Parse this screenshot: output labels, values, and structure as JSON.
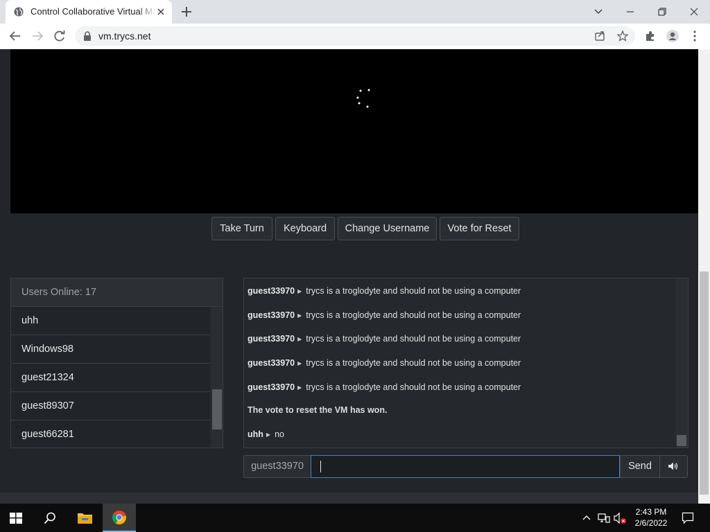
{
  "browser": {
    "tab_title": "Control Collaborative Virtual Machines",
    "url": "vm.trycs.net"
  },
  "vm": {
    "buttons": [
      "Take Turn",
      "Keyboard",
      "Change Username",
      "Vote for Reset"
    ]
  },
  "users": {
    "header": "Users Online: 17",
    "list": [
      "uhh",
      "Windows98",
      "guest21324",
      "guest89307",
      "guest66281"
    ]
  },
  "chat": {
    "messages": [
      {
        "user": "guest33970",
        "text": "trycs is a troglodyte and should not be using a computer"
      },
      {
        "user": "guest33970",
        "text": "trycs is a troglodyte and should not be using a computer"
      },
      {
        "user": "guest33970",
        "text": "trycs is a troglodyte and should not be using a computer"
      },
      {
        "user": "guest33970",
        "text": "trycs is a troglodyte and should not be using a computer"
      },
      {
        "user": "guest33970",
        "text": "trycs is a troglodyte and should not be using a computer"
      }
    ],
    "system_message": "The vote to reset the VM has won.",
    "last": {
      "user": "uhh",
      "text": "no"
    },
    "arrow": "▶",
    "username": "guest33970",
    "input_value": "",
    "send_label": "Send"
  },
  "taskbar": {
    "time": "2:43 PM",
    "date": "2/6/2022"
  },
  "colors": {
    "page_bg": "#222529",
    "accent": "#4a7ec0"
  }
}
